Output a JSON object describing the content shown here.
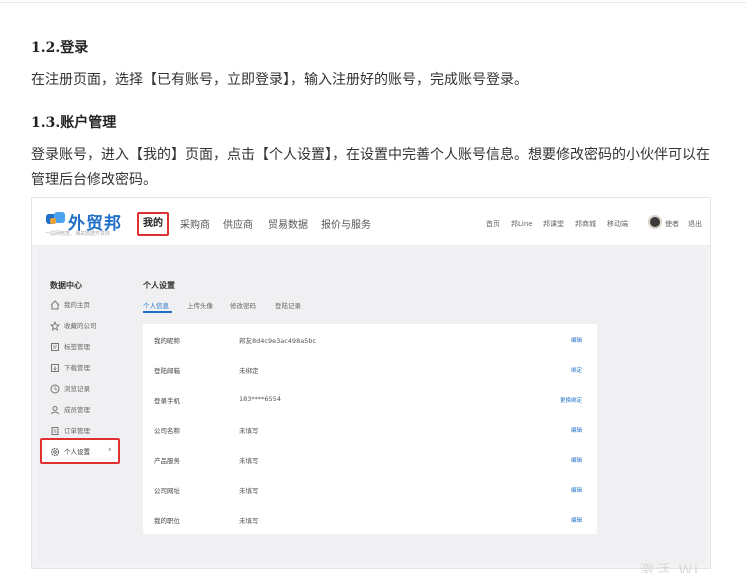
{
  "article": {
    "section_login": {
      "heading": "1.2.登录",
      "body": "在注册页面，选择【已有账号，立即登录】，输入注册好的账号，完成账号登录。"
    },
    "section_account": {
      "heading": "1.3.账户管理",
      "body": "登录账号，进入【我的】页面，点击【个人设置】，在设置中完善个人账号信息。想要修改密码的小伙伴可以在管理后台修改密码。"
    }
  },
  "screenshot": {
    "logo": {
      "name": "外贸邦",
      "slogan": "一站网络查、海关数据开发商"
    },
    "nav": {
      "mine": "我的",
      "items": [
        "采购商",
        "供应商",
        "贸易数据",
        "报价与服务"
      ]
    },
    "top_links": [
      "首页",
      "邦Line",
      "邦课堂",
      "邦商城",
      "移动端",
      "使者",
      "退出"
    ],
    "sidebar": {
      "title": "数据中心",
      "items": [
        "我的主页",
        "收藏的公司",
        "标签管理",
        "下载管理",
        "浏览记录",
        "成员管理",
        "订单管理"
      ],
      "active": "个人设置"
    },
    "main": {
      "title": "个人设置",
      "tabs": [
        "个人信息",
        "上传头像",
        "修改密码",
        "登陆记录"
      ],
      "rows": [
        {
          "label": "我的昵称",
          "value": "邦友8d4c9e3ac498a5bc",
          "action": "编辑"
        },
        {
          "label": "登陆邮箱",
          "value": "未绑定",
          "action": "绑定"
        },
        {
          "label": "登录手机",
          "value": "183****6554",
          "action": "更换绑定"
        },
        {
          "label": "公司名称",
          "value": "未填写",
          "action": "编辑"
        },
        {
          "label": "产品服务",
          "value": "未填写",
          "action": "编辑"
        },
        {
          "label": "公司网址",
          "value": "未填写",
          "action": "编辑"
        },
        {
          "label": "我的职位",
          "value": "未填写",
          "action": "编辑"
        }
      ]
    }
  },
  "watermark": "激活 Wi..."
}
